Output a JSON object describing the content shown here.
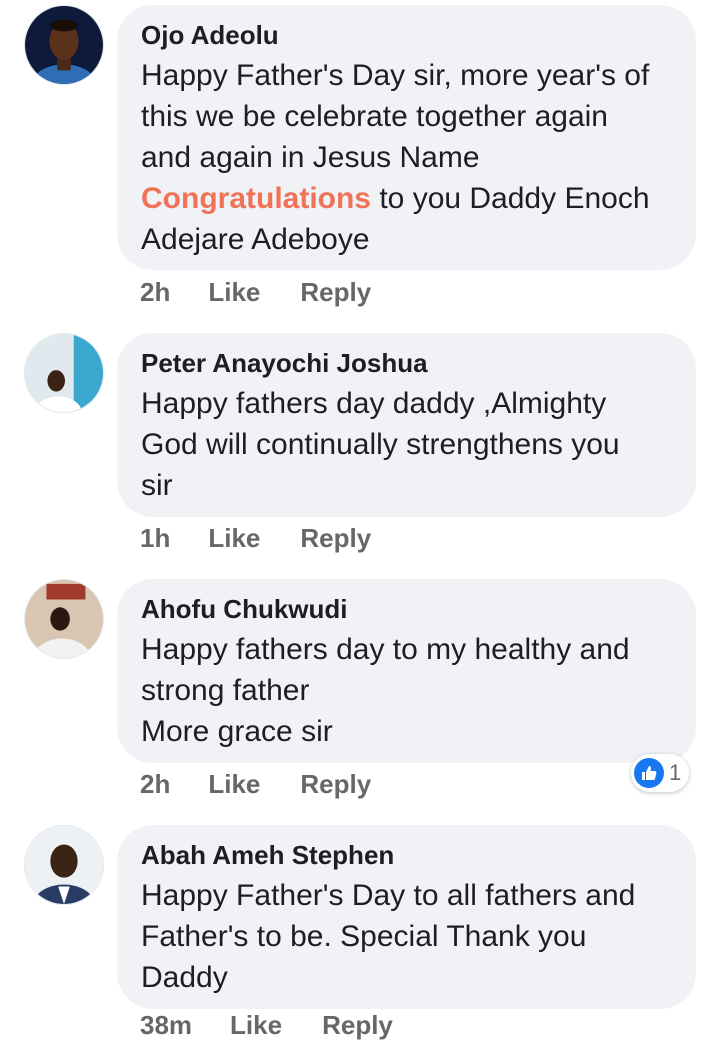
{
  "comments": [
    {
      "author": "Ojo Adeolu",
      "lines": [
        "Happy Father's Day sir, more year's of",
        "this we be celebrate together again",
        "and again in Jesus Name"
      ],
      "highlight_word": "Congratulations",
      "highlight_rest": " to you Daddy Enoch",
      "last_line": "Adejare Adeboye",
      "time": "2h",
      "like_label": "Like",
      "reply_label": "Reply"
    },
    {
      "author": "Peter Anayochi Joshua",
      "lines": [
        "Happy fathers day daddy ,Almighty",
        "God will continually strengthens you",
        "sir"
      ],
      "time": "1h",
      "like_label": "Like",
      "reply_label": "Reply"
    },
    {
      "author": "Ahofu Chukwudi",
      "lines": [
        "Happy fathers day to my healthy and",
        "strong father",
        "More grace sir"
      ],
      "time": "2h",
      "like_label": "Like",
      "reply_label": "Reply",
      "reaction_count": "1"
    },
    {
      "author": "Abah Ameh Stephen",
      "lines": [
        "Happy Father's Day to all fathers and",
        "Father's to be.  Special Thank you",
        "Daddy"
      ],
      "time": "38m",
      "like_label": "Like",
      "reply_label": "Reply"
    }
  ],
  "colors": {
    "bubble": "#f0f2f5",
    "meta": "#65676b",
    "highlight": "#f07358",
    "like_blue": "#1877f2"
  },
  "icons": {
    "reaction": "thumbs-up-icon"
  }
}
